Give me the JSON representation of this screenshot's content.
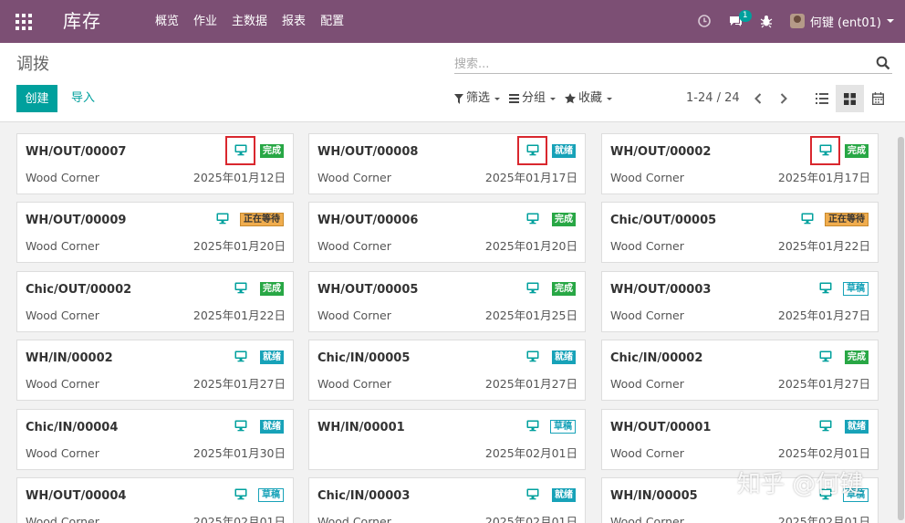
{
  "navbar": {
    "apps_icon": "apps-grid-icon",
    "brand": "库存",
    "menu": [
      "概览",
      "作业",
      "主数据",
      "报表",
      "配置"
    ],
    "message_count": "1",
    "user": "何键 (ent01)",
    "color": "#7c4f74"
  },
  "control": {
    "breadcrumb": "调拨",
    "search_placeholder": "搜索...",
    "create_label": "创建",
    "import_label": "导入",
    "filter_label": "筛选",
    "groupby_label": "分组",
    "favorites_label": "收藏",
    "pager": "1-24 / 24",
    "accent": "#00a09d"
  },
  "states": {
    "done": "完成",
    "ready": "就绪",
    "waiting": "正在等待",
    "draft": "草稿"
  },
  "cards": [
    {
      "ref": "WH/OUT/00007",
      "partner": "Wood Corner",
      "date": "2025年01月12日",
      "state": "done",
      "highlight": true
    },
    {
      "ref": "WH/OUT/00008",
      "partner": "Wood Corner",
      "date": "2025年01月17日",
      "state": "ready",
      "highlight": true
    },
    {
      "ref": "WH/OUT/00002",
      "partner": "Wood Corner",
      "date": "2025年01月17日",
      "state": "done",
      "highlight": true
    },
    {
      "ref": "WH/OUT/00009",
      "partner": "Wood Corner",
      "date": "2025年01月20日",
      "state": "waiting",
      "highlight": false
    },
    {
      "ref": "WH/OUT/00006",
      "partner": "Wood Corner",
      "date": "2025年01月20日",
      "state": "done",
      "highlight": false
    },
    {
      "ref": "Chic/OUT/00005",
      "partner": "Wood Corner",
      "date": "2025年01月22日",
      "state": "waiting",
      "highlight": false
    },
    {
      "ref": "Chic/OUT/00002",
      "partner": "Wood Corner",
      "date": "2025年01月22日",
      "state": "done",
      "highlight": false
    },
    {
      "ref": "WH/OUT/00005",
      "partner": "Wood Corner",
      "date": "2025年01月25日",
      "state": "done",
      "highlight": false
    },
    {
      "ref": "WH/OUT/00003",
      "partner": "Wood Corner",
      "date": "2025年01月27日",
      "state": "draft",
      "highlight": false
    },
    {
      "ref": "WH/IN/00002",
      "partner": "Wood Corner",
      "date": "2025年01月27日",
      "state": "ready",
      "highlight": false
    },
    {
      "ref": "Chic/IN/00005",
      "partner": "Wood Corner",
      "date": "2025年01月27日",
      "state": "ready",
      "highlight": false
    },
    {
      "ref": "Chic/IN/00002",
      "partner": "Wood Corner",
      "date": "2025年01月27日",
      "state": "done",
      "highlight": false
    },
    {
      "ref": "Chic/IN/00004",
      "partner": "Wood Corner",
      "date": "2025年01月30日",
      "state": "ready",
      "highlight": false
    },
    {
      "ref": "WH/IN/00001",
      "partner": "",
      "date": "2025年02月01日",
      "state": "draft",
      "highlight": false
    },
    {
      "ref": "WH/OUT/00001",
      "partner": "Wood Corner",
      "date": "2025年02月01日",
      "state": "ready",
      "highlight": false
    },
    {
      "ref": "WH/OUT/00004",
      "partner": "Wood Corner",
      "date": "2025年02月01日",
      "state": "draft",
      "highlight": false
    },
    {
      "ref": "Chic/IN/00003",
      "partner": "Wood Corner",
      "date": "2025年02月01日",
      "state": "ready",
      "highlight": false
    },
    {
      "ref": "WH/IN/00005",
      "partner": "Wood Corner",
      "date": "2025年02月01日",
      "state": "draft",
      "highlight": false
    }
  ],
  "watermark": "知乎 @何键"
}
